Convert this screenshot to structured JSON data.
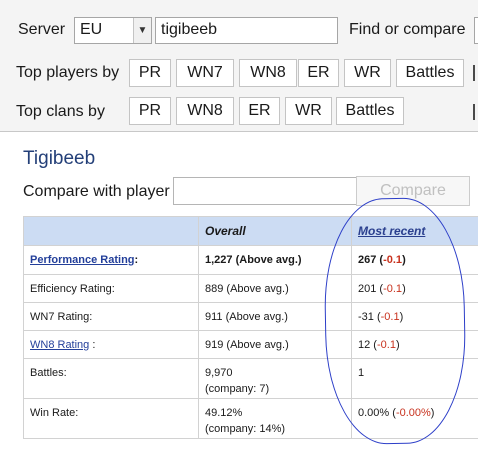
{
  "search": {
    "server_label": "Server",
    "server_value": "EU",
    "player_value": "tigibeeb",
    "find_label": "Find or compare"
  },
  "top_players": {
    "label": "Top players by",
    "buttons": [
      "PR",
      "WN7",
      "WN8",
      "ER",
      "WR",
      "Battles"
    ]
  },
  "top_clans": {
    "label": "Top clans by",
    "buttons": [
      "PR",
      "WN8",
      "ER",
      "WR",
      "Battles"
    ]
  },
  "player": {
    "name": "Tigibeeb",
    "compare_label": "Compare with player",
    "compare_input": "",
    "compare_button": "Compare"
  },
  "table": {
    "headers": {
      "overall": "Overall",
      "recent": "Most recent"
    },
    "rows": [
      {
        "label": "Performance Rating",
        "suffix": ":",
        "overall": "1,227 (Above avg.)",
        "recent_value": "267",
        "recent_open": " (",
        "recent_delta": "-0.1",
        "recent_close": ")"
      },
      {
        "label": "Efficiency Rating:",
        "overall": "889 (Above avg.)",
        "recent_value": "201",
        "recent_open": " (",
        "recent_delta": "-0.1",
        "recent_close": ")"
      },
      {
        "label": "WN7 Rating:",
        "overall": "911 (Above avg.)",
        "recent_value": "-31",
        "recent_open": " (",
        "recent_delta": "-0.1",
        "recent_close": ")"
      },
      {
        "label": "WN8 Rating",
        "suffix": " :",
        "overall": "919 (Above avg.)",
        "recent_value": "12",
        "recent_open": " (",
        "recent_delta": "-0.1",
        "recent_close": ")"
      },
      {
        "label": "Battles:",
        "overall": "9,970",
        "overall_sub": "(company: 7)",
        "recent_value": "1"
      },
      {
        "label": "Win Rate:",
        "overall": "49.12%",
        "overall_sub": "(company: 14%)",
        "recent_value": "0.00%",
        "recent_open": " (",
        "recent_delta": "-0.00%",
        "recent_close": ")"
      }
    ]
  },
  "colors": {
    "title": "#233f78",
    "header_bg": "#ccdcf3",
    "link": "#233f9a",
    "delta": "#c8321e",
    "annotation": "#2c3ec8"
  }
}
